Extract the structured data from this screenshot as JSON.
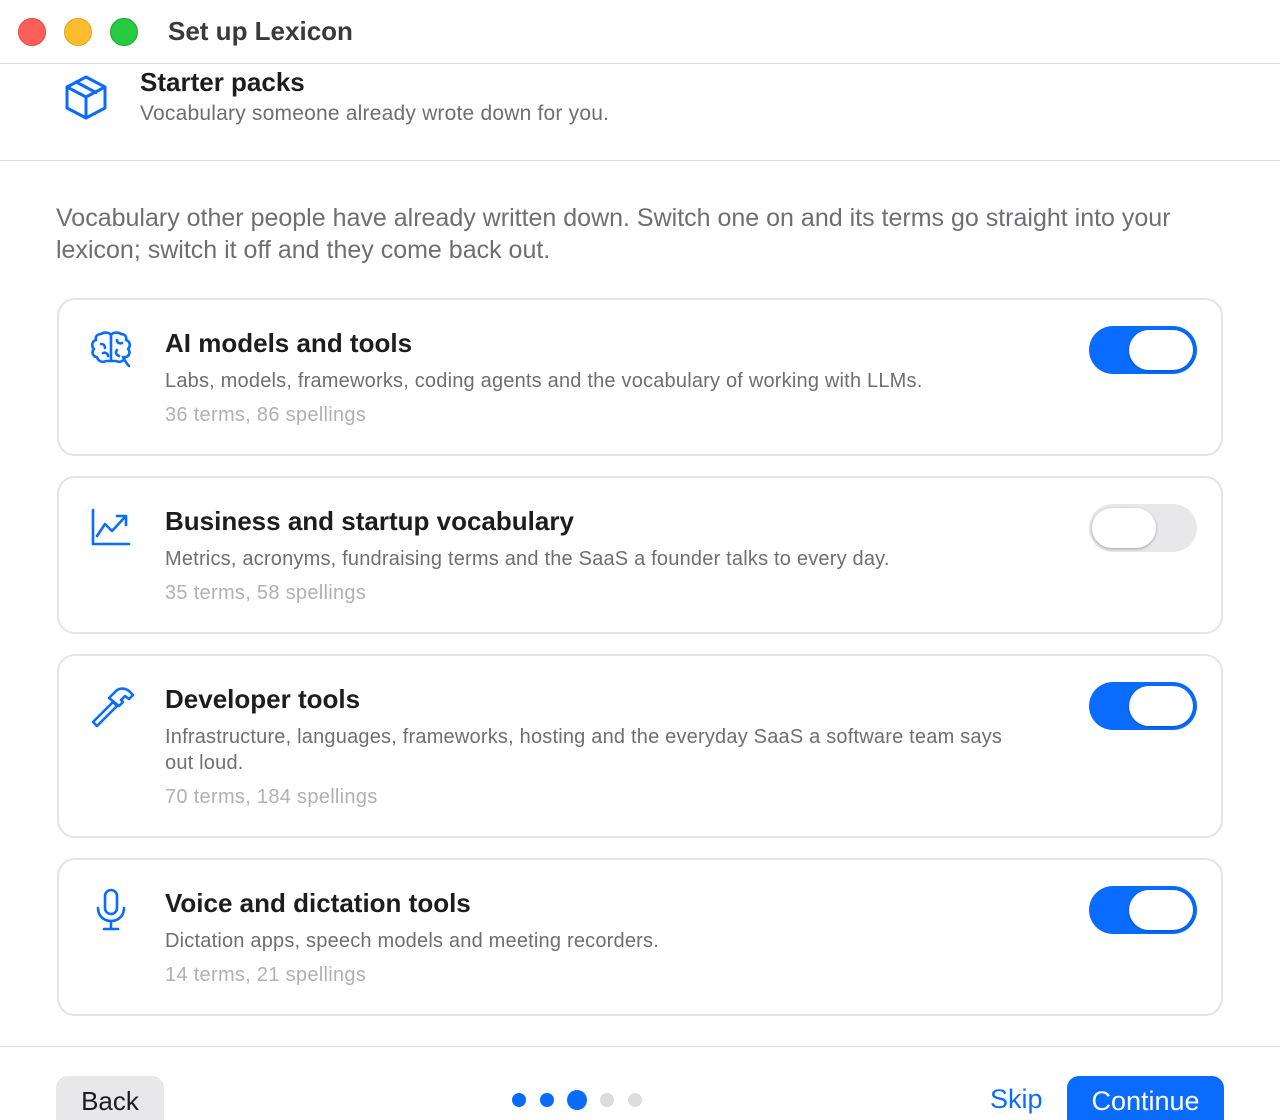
{
  "window": {
    "title": "Set up Lexicon"
  },
  "header": {
    "icon": "cube-icon",
    "title": "Starter packs",
    "subtitle": "Vocabulary someone already wrote down for you."
  },
  "intro": "Vocabulary other people have already written down. Switch one on and its terms go straight into your lexicon; switch it off and they come back out.",
  "packs": [
    {
      "icon": "brain-icon",
      "title": "AI models and tools",
      "description": "Labs, models, frameworks, coding agents and the vocabulary of working with LLMs.",
      "meta": "36 terms, 86 spellings",
      "enabled": true
    },
    {
      "icon": "chart-trend-icon",
      "title": "Business and startup vocabulary",
      "description": "Metrics, acronyms, fundraising terms and the SaaS a founder talks to every day.",
      "meta": "35 terms, 58 spellings",
      "enabled": false
    },
    {
      "icon": "hammer-icon",
      "title": "Developer tools",
      "description": "Infrastructure, languages, frameworks, hosting and the everyday SaaS a software team says out loud.",
      "meta": "70 terms, 184 spellings",
      "enabled": true
    },
    {
      "icon": "microphone-icon",
      "title": "Voice and dictation tools",
      "description": "Dictation apps, speech models and meeting recorders.",
      "meta": "14 terms, 21 spellings",
      "enabled": true
    }
  ],
  "footer": {
    "back_label": "Back",
    "skip_label": "Skip",
    "continue_label": "Continue",
    "steps_total": 5,
    "current_step": 3
  },
  "colors": {
    "accent": "#0a6cff",
    "toggle_off": "#e8e8ea",
    "close": "#ff5f57",
    "minimize": "#febc2e",
    "maximize": "#28c840"
  }
}
